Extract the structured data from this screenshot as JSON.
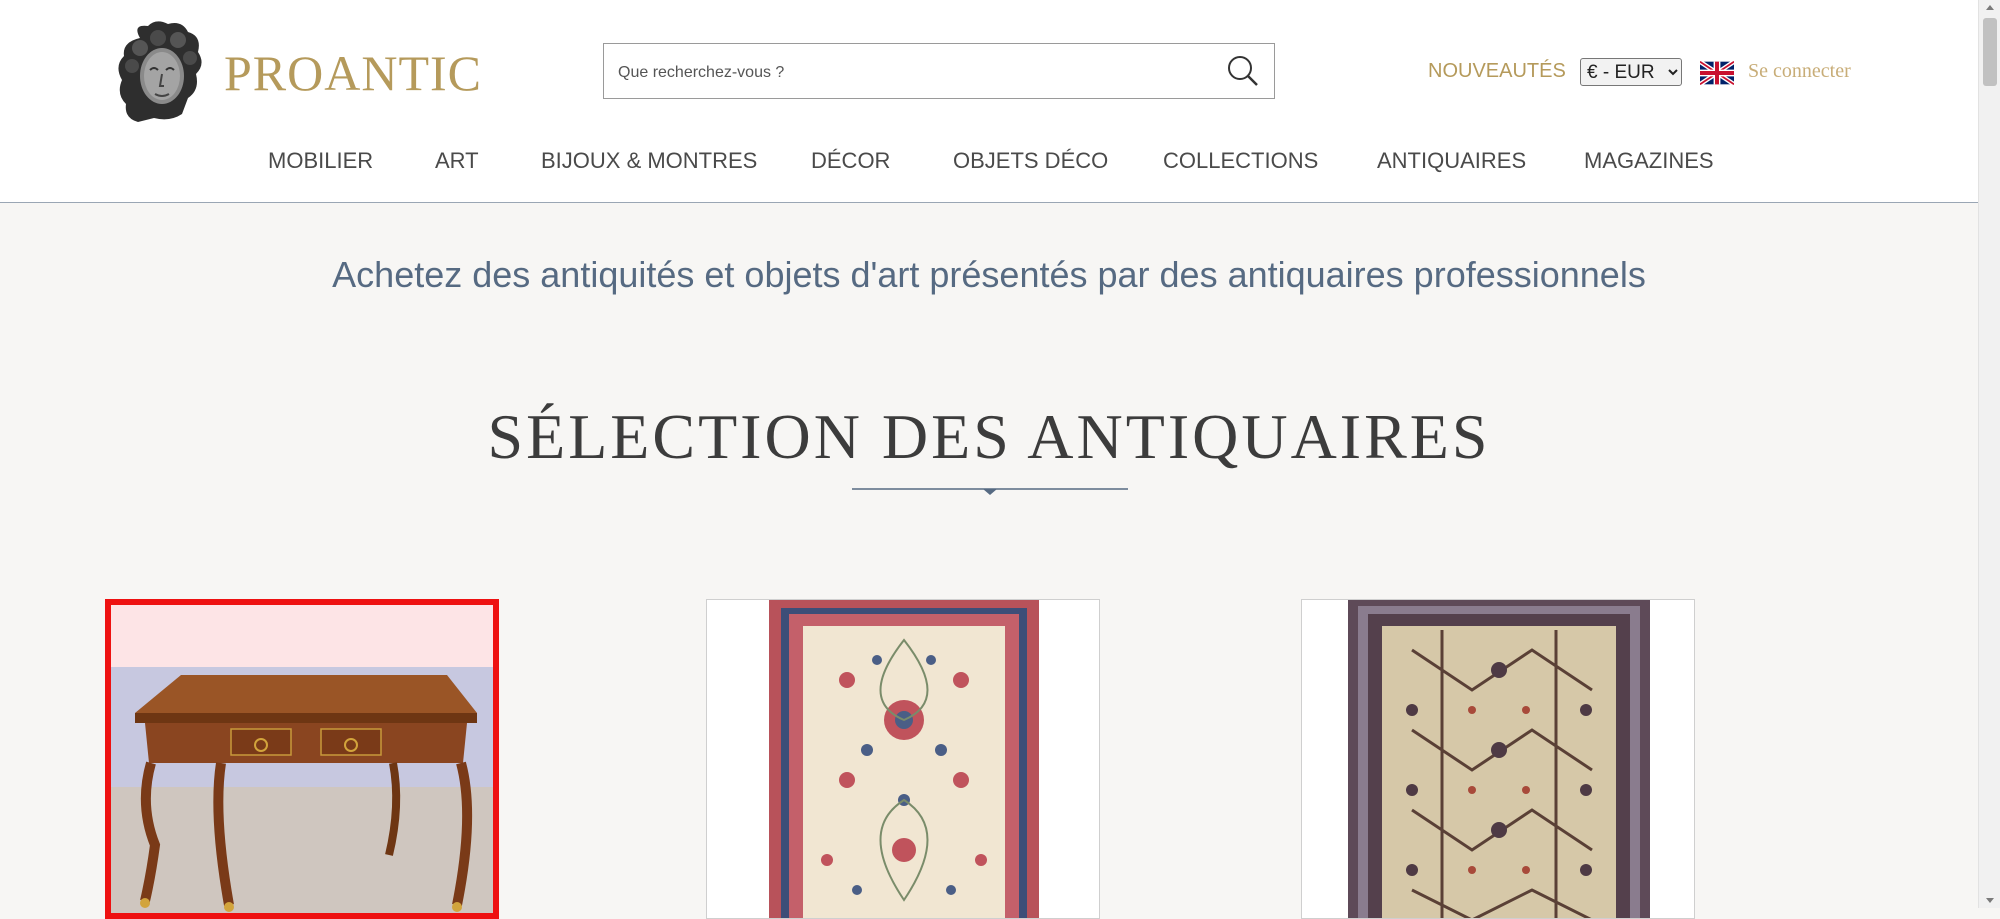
{
  "brand": {
    "name": "PROANTIC",
    "logo_icon": "statue-head-logo"
  },
  "search": {
    "placeholder": "Que recherchez-vous ?",
    "value": "",
    "icon": "search-icon"
  },
  "header": {
    "new_label": "NOUVEAUTÉS",
    "currency": {
      "selected": "€ - EUR",
      "options": [
        "€ - EUR"
      ]
    },
    "language_icon": "uk-flag-icon",
    "login_label": "Se connecter"
  },
  "nav": {
    "items": [
      {
        "label": "MOBILIER"
      },
      {
        "label": "ART"
      },
      {
        "label": "BIJOUX & MONTRES"
      },
      {
        "label": "DÉCOR"
      },
      {
        "label": "OBJETS DÉCO"
      },
      {
        "label": "COLLECTIONS"
      },
      {
        "label": "ANTIQUAIRES"
      },
      {
        "label": "MAGAZINES"
      }
    ]
  },
  "main": {
    "tagline": "Achetez des antiquités et objets d'art présentés par des antiquaires professionnels",
    "section_title": "SÉLECTION DES ANTIQUAIRES",
    "products": [
      {
        "image": "louis-xv-desk",
        "selected": true
      },
      {
        "image": "persian-carpet-ivory",
        "selected": false
      },
      {
        "image": "persian-carpet-ornate",
        "selected": false
      }
    ]
  },
  "colors": {
    "brand_gold": "#b59a5b",
    "login_gold": "#c8ad78",
    "tagline_blue": "#566a82",
    "background": "#f7f6f4",
    "selection_red": "#ee1111"
  }
}
